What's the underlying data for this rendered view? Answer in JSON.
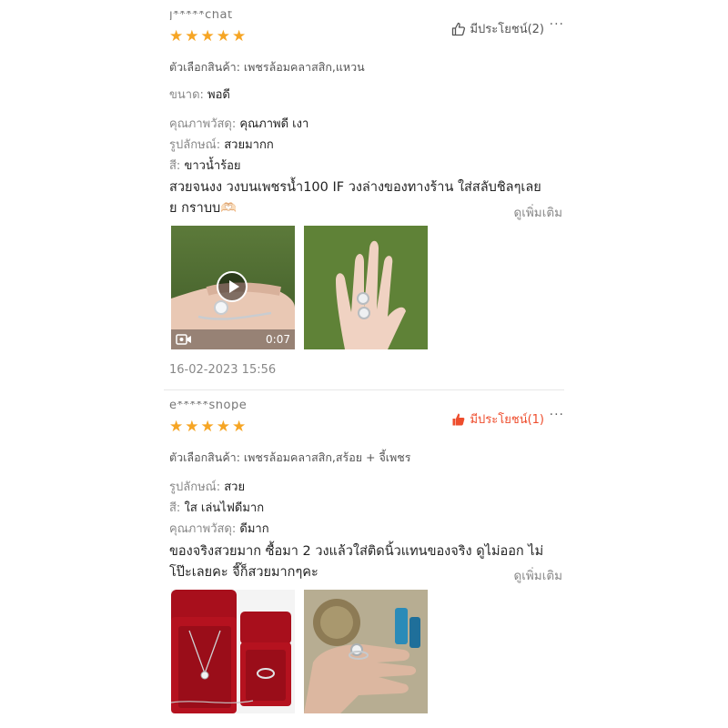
{
  "reviews": [
    {
      "username": "j*****chat",
      "rating": 5,
      "helpful_label": "มีประโยชน์(2)",
      "helpful_active": false,
      "more_label": "···",
      "variant_label": "ตัวเลือกสินค้า:",
      "variant_value": "เพชรล้อมคลาสสิก,แหวน",
      "attributes": [
        {
          "label": "ขนาด:",
          "value": "พอดี"
        },
        {
          "label": "คุณภาพวัสดุ:",
          "value": "คุณภาพดี เงา"
        },
        {
          "label": "รูปลักษณ์:",
          "value": "สวยมากก"
        },
        {
          "label": "สี:",
          "value": "ขาวน้ำร้อย"
        }
      ],
      "comment_line1": "สวยจนงง วงบนเพชรน้ำ100 IF วงล่างของทางร้าน ใส่สลับชิลๆเลย",
      "comment_line2": "ย กราบบ🫶🏻",
      "see_more": "ดูเพิ่มเติม",
      "video_duration": "0:07",
      "timestamp": "16-02-2023 15:56"
    },
    {
      "username": "e*****shope",
      "rating": 5,
      "helpful_label": "มีประโยชน์(1)",
      "helpful_active": true,
      "more_label": "···",
      "variant_label": "ตัวเลือกสินค้า:",
      "variant_value": "เพชรล้อมคลาสสิก,สร้อย + จี้เพชร",
      "attributes": [
        {
          "label": "รูปลักษณ์:",
          "value": "สวย"
        },
        {
          "label": "สี:",
          "value": "ใส เล่นไฟดีมาก"
        },
        {
          "label": "คุณภาพวัสดุ:",
          "value": "ดีมาก"
        }
      ],
      "comment_line1": "ของจริงสวยมาก ซื้อมา 2 วงแล้วใส่ติดนิ้วแทนของจริง ดูไม่ออก ไม่",
      "comment_line2": "โป๊ะเลยคะ จี๊ก็สวยมากๆคะ",
      "see_more": "ดูเพิ่มเติม"
    }
  ],
  "colors": {
    "star": "#f6a524",
    "accent": "#ee4d2d",
    "muted": "#888888"
  },
  "icons": {
    "helpful": "thumbs-up-icon",
    "more": "more-dots-icon",
    "play": "play-icon",
    "video": "video-camera-icon"
  }
}
